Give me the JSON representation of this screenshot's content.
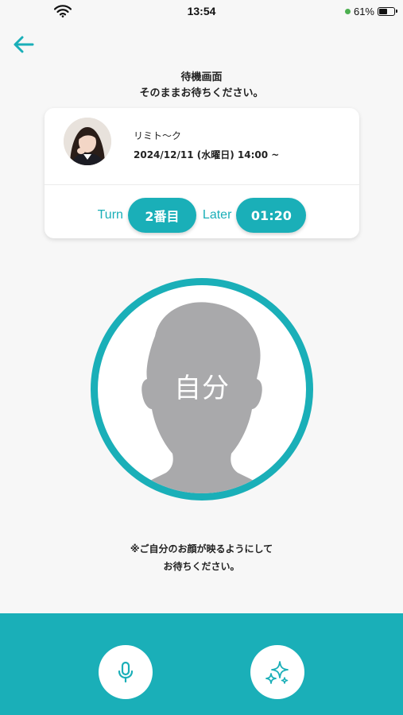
{
  "status": {
    "time": "13:54",
    "battery": "61%",
    "battery_level": 0.61
  },
  "header": {
    "title": "待機画面",
    "subtitle": "そのままお待ちください。"
  },
  "host": {
    "name": "リミト〜ク",
    "datetime": "2024/12/11 (水曜日) 14:00 ~"
  },
  "queue": {
    "turn_label": "Turn",
    "turn_value": "2番目",
    "later_label": "Later",
    "later_value": "01:20"
  },
  "self_view": {
    "label": "自分"
  },
  "note": {
    "line1": "※ご自分のお顔が映るようにして",
    "line2": "お待ちください。"
  },
  "colors": {
    "accent": "#1aafb8",
    "background": "#f7f7f7"
  },
  "icons": {
    "back": "arrow-left-icon",
    "mic": "microphone-icon",
    "effects": "sparkles-icon",
    "wifi": "wifi-icon",
    "battery": "battery-icon"
  }
}
